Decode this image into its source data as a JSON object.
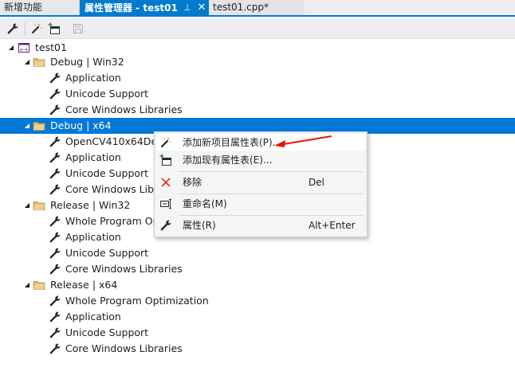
{
  "tabs": {
    "new_feature": "新增功能",
    "property_manager": "属性管理器 - test01",
    "pin_glyph": "⊥",
    "close_glyph": "✕",
    "cpp_file": "test01.cpp*"
  },
  "toolbar": {
    "icons": [
      "wrench-icon",
      "magic-wand-icon",
      "add-existing-sheet-icon",
      "save-icon"
    ]
  },
  "tree": {
    "project": "test01",
    "groups": [
      {
        "label": "Debug | Win32",
        "selected": false,
        "items": [
          "Application",
          "Unicode Support",
          "Core Windows Libraries"
        ]
      },
      {
        "label": "Debug | x64",
        "selected": true,
        "items": [
          "OpenCV410x64Deb",
          "Application",
          "Unicode Support",
          "Core Windows Libra"
        ]
      },
      {
        "label": "Release | Win32",
        "selected": false,
        "items": [
          "Whole Program Op",
          "Application",
          "Unicode Support",
          "Core Windows Libraries"
        ]
      },
      {
        "label": "Release | x64",
        "selected": false,
        "items": [
          "Whole Program Optimization",
          "Application",
          "Unicode Support",
          "Core Windows Libraries"
        ]
      }
    ]
  },
  "context_menu": {
    "items": [
      {
        "label": "添加新项目属性表(P)...",
        "shortcut": "",
        "icon": "magic-wand-icon"
      },
      {
        "label": "添加现有属性表(E)...",
        "shortcut": "",
        "icon": "add-existing-sheet-icon"
      },
      {
        "label": "移除",
        "shortcut": "Del",
        "icon": "remove-x-icon"
      },
      {
        "label": "重命名(M)",
        "shortcut": "",
        "icon": "rename-icon"
      },
      {
        "label": "属性(R)",
        "shortcut": "Alt+Enter",
        "icon": "wrench-icon"
      }
    ]
  },
  "colors": {
    "accent": "#007acc",
    "selection": "#0078d7",
    "folder": "#dcb67a",
    "annotation_arrow": "#e51400"
  }
}
